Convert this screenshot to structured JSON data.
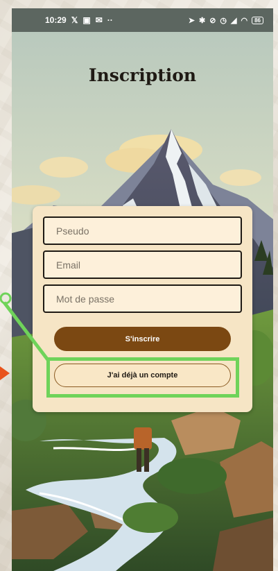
{
  "status_bar": {
    "time": "10:29",
    "left_icons": [
      "x-icon",
      "notification-icon",
      "mail-icon",
      "more-icon"
    ],
    "right_icons": [
      "location-icon",
      "bluetooth-icon",
      "alarm-off-icon",
      "alarm-icon",
      "signal-icon",
      "wifi-icon"
    ],
    "battery": "86"
  },
  "page": {
    "title": "Inscription"
  },
  "form": {
    "pseudo_placeholder": "Pseudo",
    "email_placeholder": "Email",
    "password_placeholder": "Mot de passe",
    "submit_label": "S'inscrire",
    "login_label": "J'ai déjà un compte"
  },
  "annotations": {
    "highlight_color": "#6fd35a",
    "arrow_color": "#e8531c"
  },
  "colors": {
    "primary_button": "#7b4812",
    "card_background": "#f6e5c5"
  }
}
